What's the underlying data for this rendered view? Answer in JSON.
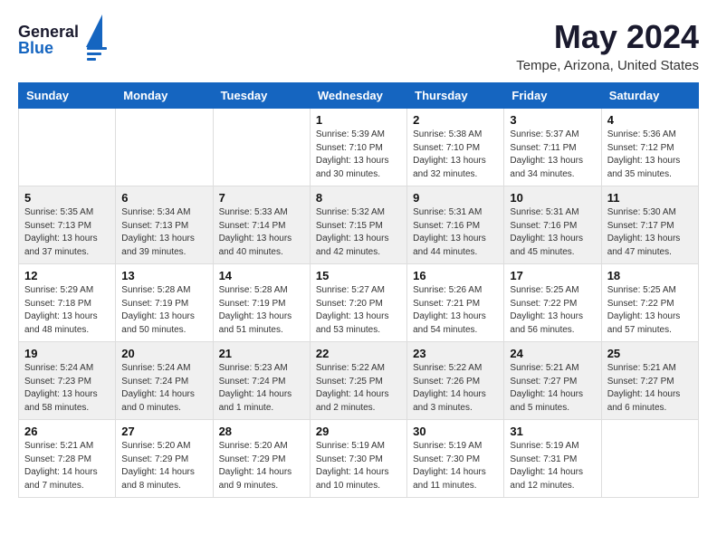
{
  "logo": {
    "general": "General",
    "blue": "Blue"
  },
  "header": {
    "title": "May 2024",
    "subtitle": "Tempe, Arizona, United States"
  },
  "weekdays": [
    "Sunday",
    "Monday",
    "Tuesday",
    "Wednesday",
    "Thursday",
    "Friday",
    "Saturday"
  ],
  "weeks": [
    [
      {
        "day": "",
        "info": ""
      },
      {
        "day": "",
        "info": ""
      },
      {
        "day": "",
        "info": ""
      },
      {
        "day": "1",
        "info": "Sunrise: 5:39 AM\nSunset: 7:10 PM\nDaylight: 13 hours\nand 30 minutes."
      },
      {
        "day": "2",
        "info": "Sunrise: 5:38 AM\nSunset: 7:10 PM\nDaylight: 13 hours\nand 32 minutes."
      },
      {
        "day": "3",
        "info": "Sunrise: 5:37 AM\nSunset: 7:11 PM\nDaylight: 13 hours\nand 34 minutes."
      },
      {
        "day": "4",
        "info": "Sunrise: 5:36 AM\nSunset: 7:12 PM\nDaylight: 13 hours\nand 35 minutes."
      }
    ],
    [
      {
        "day": "5",
        "info": "Sunrise: 5:35 AM\nSunset: 7:13 PM\nDaylight: 13 hours\nand 37 minutes."
      },
      {
        "day": "6",
        "info": "Sunrise: 5:34 AM\nSunset: 7:13 PM\nDaylight: 13 hours\nand 39 minutes."
      },
      {
        "day": "7",
        "info": "Sunrise: 5:33 AM\nSunset: 7:14 PM\nDaylight: 13 hours\nand 40 minutes."
      },
      {
        "day": "8",
        "info": "Sunrise: 5:32 AM\nSunset: 7:15 PM\nDaylight: 13 hours\nand 42 minutes."
      },
      {
        "day": "9",
        "info": "Sunrise: 5:31 AM\nSunset: 7:16 PM\nDaylight: 13 hours\nand 44 minutes."
      },
      {
        "day": "10",
        "info": "Sunrise: 5:31 AM\nSunset: 7:16 PM\nDaylight: 13 hours\nand 45 minutes."
      },
      {
        "day": "11",
        "info": "Sunrise: 5:30 AM\nSunset: 7:17 PM\nDaylight: 13 hours\nand 47 minutes."
      }
    ],
    [
      {
        "day": "12",
        "info": "Sunrise: 5:29 AM\nSunset: 7:18 PM\nDaylight: 13 hours\nand 48 minutes."
      },
      {
        "day": "13",
        "info": "Sunrise: 5:28 AM\nSunset: 7:19 PM\nDaylight: 13 hours\nand 50 minutes."
      },
      {
        "day": "14",
        "info": "Sunrise: 5:28 AM\nSunset: 7:19 PM\nDaylight: 13 hours\nand 51 minutes."
      },
      {
        "day": "15",
        "info": "Sunrise: 5:27 AM\nSunset: 7:20 PM\nDaylight: 13 hours\nand 53 minutes."
      },
      {
        "day": "16",
        "info": "Sunrise: 5:26 AM\nSunset: 7:21 PM\nDaylight: 13 hours\nand 54 minutes."
      },
      {
        "day": "17",
        "info": "Sunrise: 5:25 AM\nSunset: 7:22 PM\nDaylight: 13 hours\nand 56 minutes."
      },
      {
        "day": "18",
        "info": "Sunrise: 5:25 AM\nSunset: 7:22 PM\nDaylight: 13 hours\nand 57 minutes."
      }
    ],
    [
      {
        "day": "19",
        "info": "Sunrise: 5:24 AM\nSunset: 7:23 PM\nDaylight: 13 hours\nand 58 minutes."
      },
      {
        "day": "20",
        "info": "Sunrise: 5:24 AM\nSunset: 7:24 PM\nDaylight: 14 hours\nand 0 minutes."
      },
      {
        "day": "21",
        "info": "Sunrise: 5:23 AM\nSunset: 7:24 PM\nDaylight: 14 hours\nand 1 minute."
      },
      {
        "day": "22",
        "info": "Sunrise: 5:22 AM\nSunset: 7:25 PM\nDaylight: 14 hours\nand 2 minutes."
      },
      {
        "day": "23",
        "info": "Sunrise: 5:22 AM\nSunset: 7:26 PM\nDaylight: 14 hours\nand 3 minutes."
      },
      {
        "day": "24",
        "info": "Sunrise: 5:21 AM\nSunset: 7:27 PM\nDaylight: 14 hours\nand 5 minutes."
      },
      {
        "day": "25",
        "info": "Sunrise: 5:21 AM\nSunset: 7:27 PM\nDaylight: 14 hours\nand 6 minutes."
      }
    ],
    [
      {
        "day": "26",
        "info": "Sunrise: 5:21 AM\nSunset: 7:28 PM\nDaylight: 14 hours\nand 7 minutes."
      },
      {
        "day": "27",
        "info": "Sunrise: 5:20 AM\nSunset: 7:29 PM\nDaylight: 14 hours\nand 8 minutes."
      },
      {
        "day": "28",
        "info": "Sunrise: 5:20 AM\nSunset: 7:29 PM\nDaylight: 14 hours\nand 9 minutes."
      },
      {
        "day": "29",
        "info": "Sunrise: 5:19 AM\nSunset: 7:30 PM\nDaylight: 14 hours\nand 10 minutes."
      },
      {
        "day": "30",
        "info": "Sunrise: 5:19 AM\nSunset: 7:30 PM\nDaylight: 14 hours\nand 11 minutes."
      },
      {
        "day": "31",
        "info": "Sunrise: 5:19 AM\nSunset: 7:31 PM\nDaylight: 14 hours\nand 12 minutes."
      },
      {
        "day": "",
        "info": ""
      }
    ]
  ]
}
